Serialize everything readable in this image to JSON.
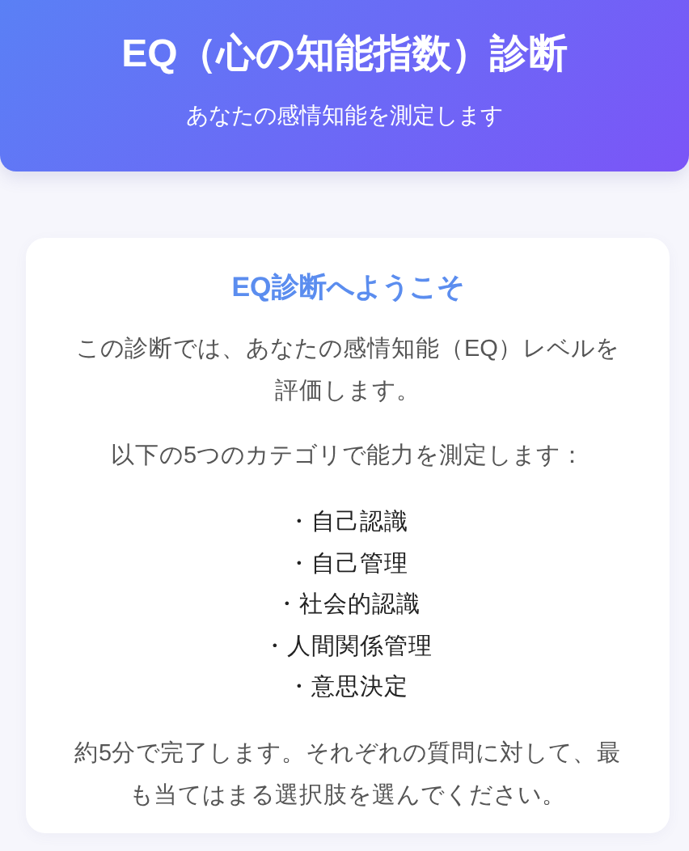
{
  "header": {
    "title": "EQ（心の知能指数）診断",
    "subtitle": "あなたの感情知能を測定します"
  },
  "card": {
    "title": "EQ診断へようこそ",
    "intro": "この診断では、あなたの感情知能（EQ）レベルを評価します。",
    "lead": "以下の5つのカテゴリで能力を測定します：",
    "categories": [
      "・自己認識",
      "・自己管理",
      "・社会的認識",
      "・人間関係管理",
      "・意思決定"
    ],
    "note": "約5分で完了します。それぞれの質問に対して、最も当てはまる選択肢を選んでください。"
  }
}
